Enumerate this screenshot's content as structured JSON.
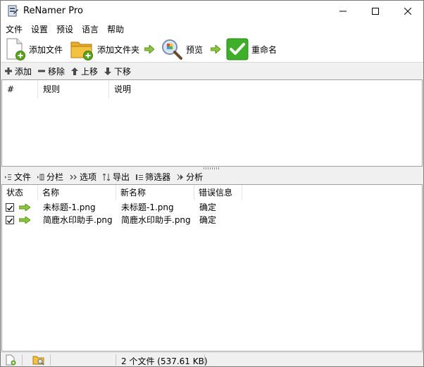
{
  "window": {
    "title": "ReNamer Pro"
  },
  "menu": [
    "文件",
    "设置",
    "预设",
    "语言",
    "帮助"
  ],
  "toolbar": {
    "add_files": "添加文件",
    "add_folder": "添加文件夹",
    "preview": "预览",
    "rename": "重命名"
  },
  "rules_toolbar": {
    "add": "添加",
    "remove": "移除",
    "move_up": "上移",
    "move_down": "下移"
  },
  "rules_table": {
    "columns": [
      "#",
      "规则",
      "说明"
    ]
  },
  "files_toolbar": {
    "files": "文件",
    "columns": "分栏",
    "options": "选项",
    "export": "导出",
    "filters": "筛选器",
    "analyze": "分析"
  },
  "files_table": {
    "columns": [
      "状态",
      "名称",
      "新名称",
      "错误信息"
    ],
    "rows": [
      {
        "checked": true,
        "name": "未标题-1.png",
        "new_name": "未标题-1.png",
        "error": "确定"
      },
      {
        "checked": true,
        "name": "简鹿水印助手.png",
        "new_name": "简鹿水印助手.png",
        "error": "确定"
      }
    ]
  },
  "statusbar": {
    "summary": "2 个文件 (537.61 KB)"
  },
  "colors": {
    "accent_green": "#5aa51e",
    "check_green": "#3fae29",
    "folder_yellow": "#f3c23f"
  }
}
